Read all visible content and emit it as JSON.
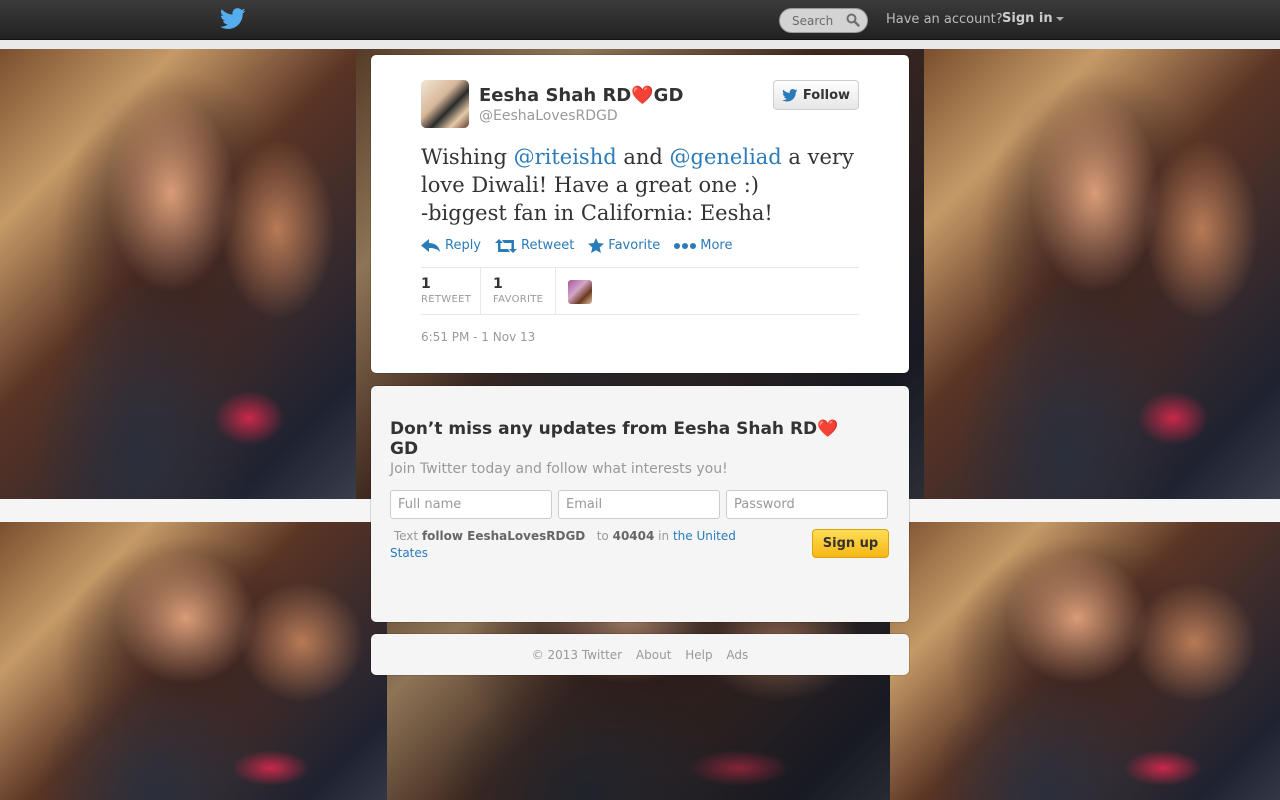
{
  "topbar": {
    "search_placeholder": "Search",
    "have_account": "Have an account?",
    "sign_in": "Sign in"
  },
  "tweet": {
    "fullname": "Eesha Shah RD❤️GD",
    "username": "@EeshaLovesRDGD",
    "follow_label": "Follow",
    "text_1": "Wishing ",
    "mention_1": "@riteishd",
    "text_2": " and ",
    "mention_2": "@geneliad",
    "text_3": " a very love Diwali! Have a great one :)",
    "text_4": "-biggest fan in California: Eesha!",
    "actions": {
      "reply": "Reply",
      "retweet": "Retweet",
      "favorite": "Favorite",
      "more": "More"
    },
    "stats": {
      "retweet_count": "1",
      "retweet_label": "RETWEET",
      "favorite_count": "1",
      "favorite_label": "FAVORITE"
    },
    "timestamp": "6:51 PM - 1 Nov 13"
  },
  "signup": {
    "title": "Don’t miss any updates from Eesha Shah RD❤️GD",
    "subtitle": "Join Twitter today and follow what interests you!",
    "fullname_placeholder": "Full name",
    "email_placeholder": "Email",
    "password_placeholder": "Password",
    "sms_text": "Text",
    "sms_command": "follow EeshaLovesRDGD",
    "sms_to": "to",
    "sms_number": "40404",
    "sms_in": "in",
    "sms_country": "the United States",
    "signup_label": "Sign up"
  },
  "footer": {
    "copyright": "© 2013 Twitter",
    "about": "About",
    "help": "Help",
    "ads": "Ads"
  },
  "colors": {
    "link": "#2b7bb9",
    "topbar": "#2a2a2a",
    "signup_button": "#f6b716"
  },
  "icons": [
    "twitter-bird-icon",
    "search-icon",
    "reply-icon",
    "retweet-icon",
    "star-icon",
    "more-dots-icon"
  ]
}
